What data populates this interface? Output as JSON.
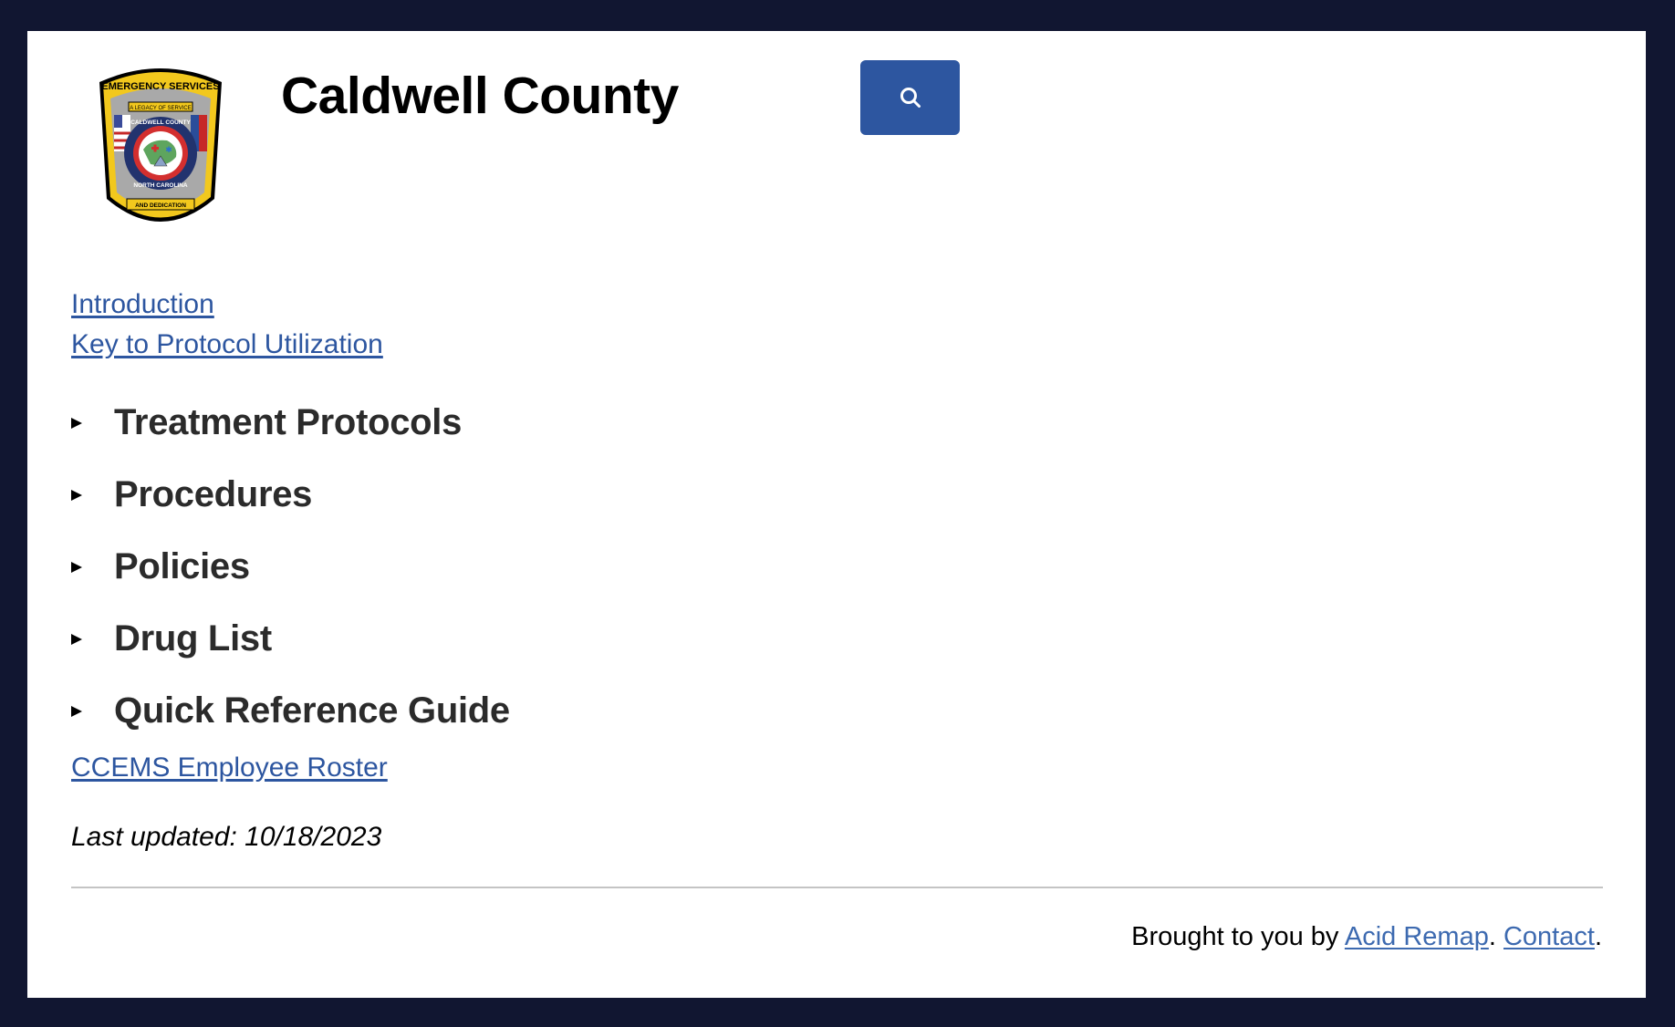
{
  "header": {
    "title": "Caldwell County",
    "logo_alt": "Caldwell County Emergency Services patch",
    "logo_text": {
      "top": "EMERGENCY SERVICES",
      "ribbon_top": "A LEGACY OF SERVICE",
      "ring_top": "CALDWELL COUNTY",
      "ring_bottom": "NORTH CAROLINA",
      "ribbon_bottom": "AND DEDICATION"
    },
    "search_button_icon": "search-icon"
  },
  "top_links": [
    {
      "label": "Introduction"
    },
    {
      "label": "Key to Protocol Utilization"
    }
  ],
  "sections": [
    {
      "label": "Treatment Protocols",
      "expanded": false
    },
    {
      "label": "Procedures",
      "expanded": false
    },
    {
      "label": "Policies",
      "expanded": false
    },
    {
      "label": "Drug List",
      "expanded": false
    },
    {
      "label": "Quick Reference Guide",
      "expanded": false
    }
  ],
  "roster_link": "CCEMS Employee Roster",
  "last_updated": "Last updated: 10/18/2023",
  "footer": {
    "prefix": "Brought to you by ",
    "brand_link": "Acid Remap",
    "separator": ". ",
    "contact_link": "Contact",
    "suffix": "."
  },
  "colors": {
    "background": "#111631",
    "panel": "#ffffff",
    "accent": "#2d56a0",
    "heading_text": "#2b2b2b",
    "divider": "#c4c4c4"
  }
}
